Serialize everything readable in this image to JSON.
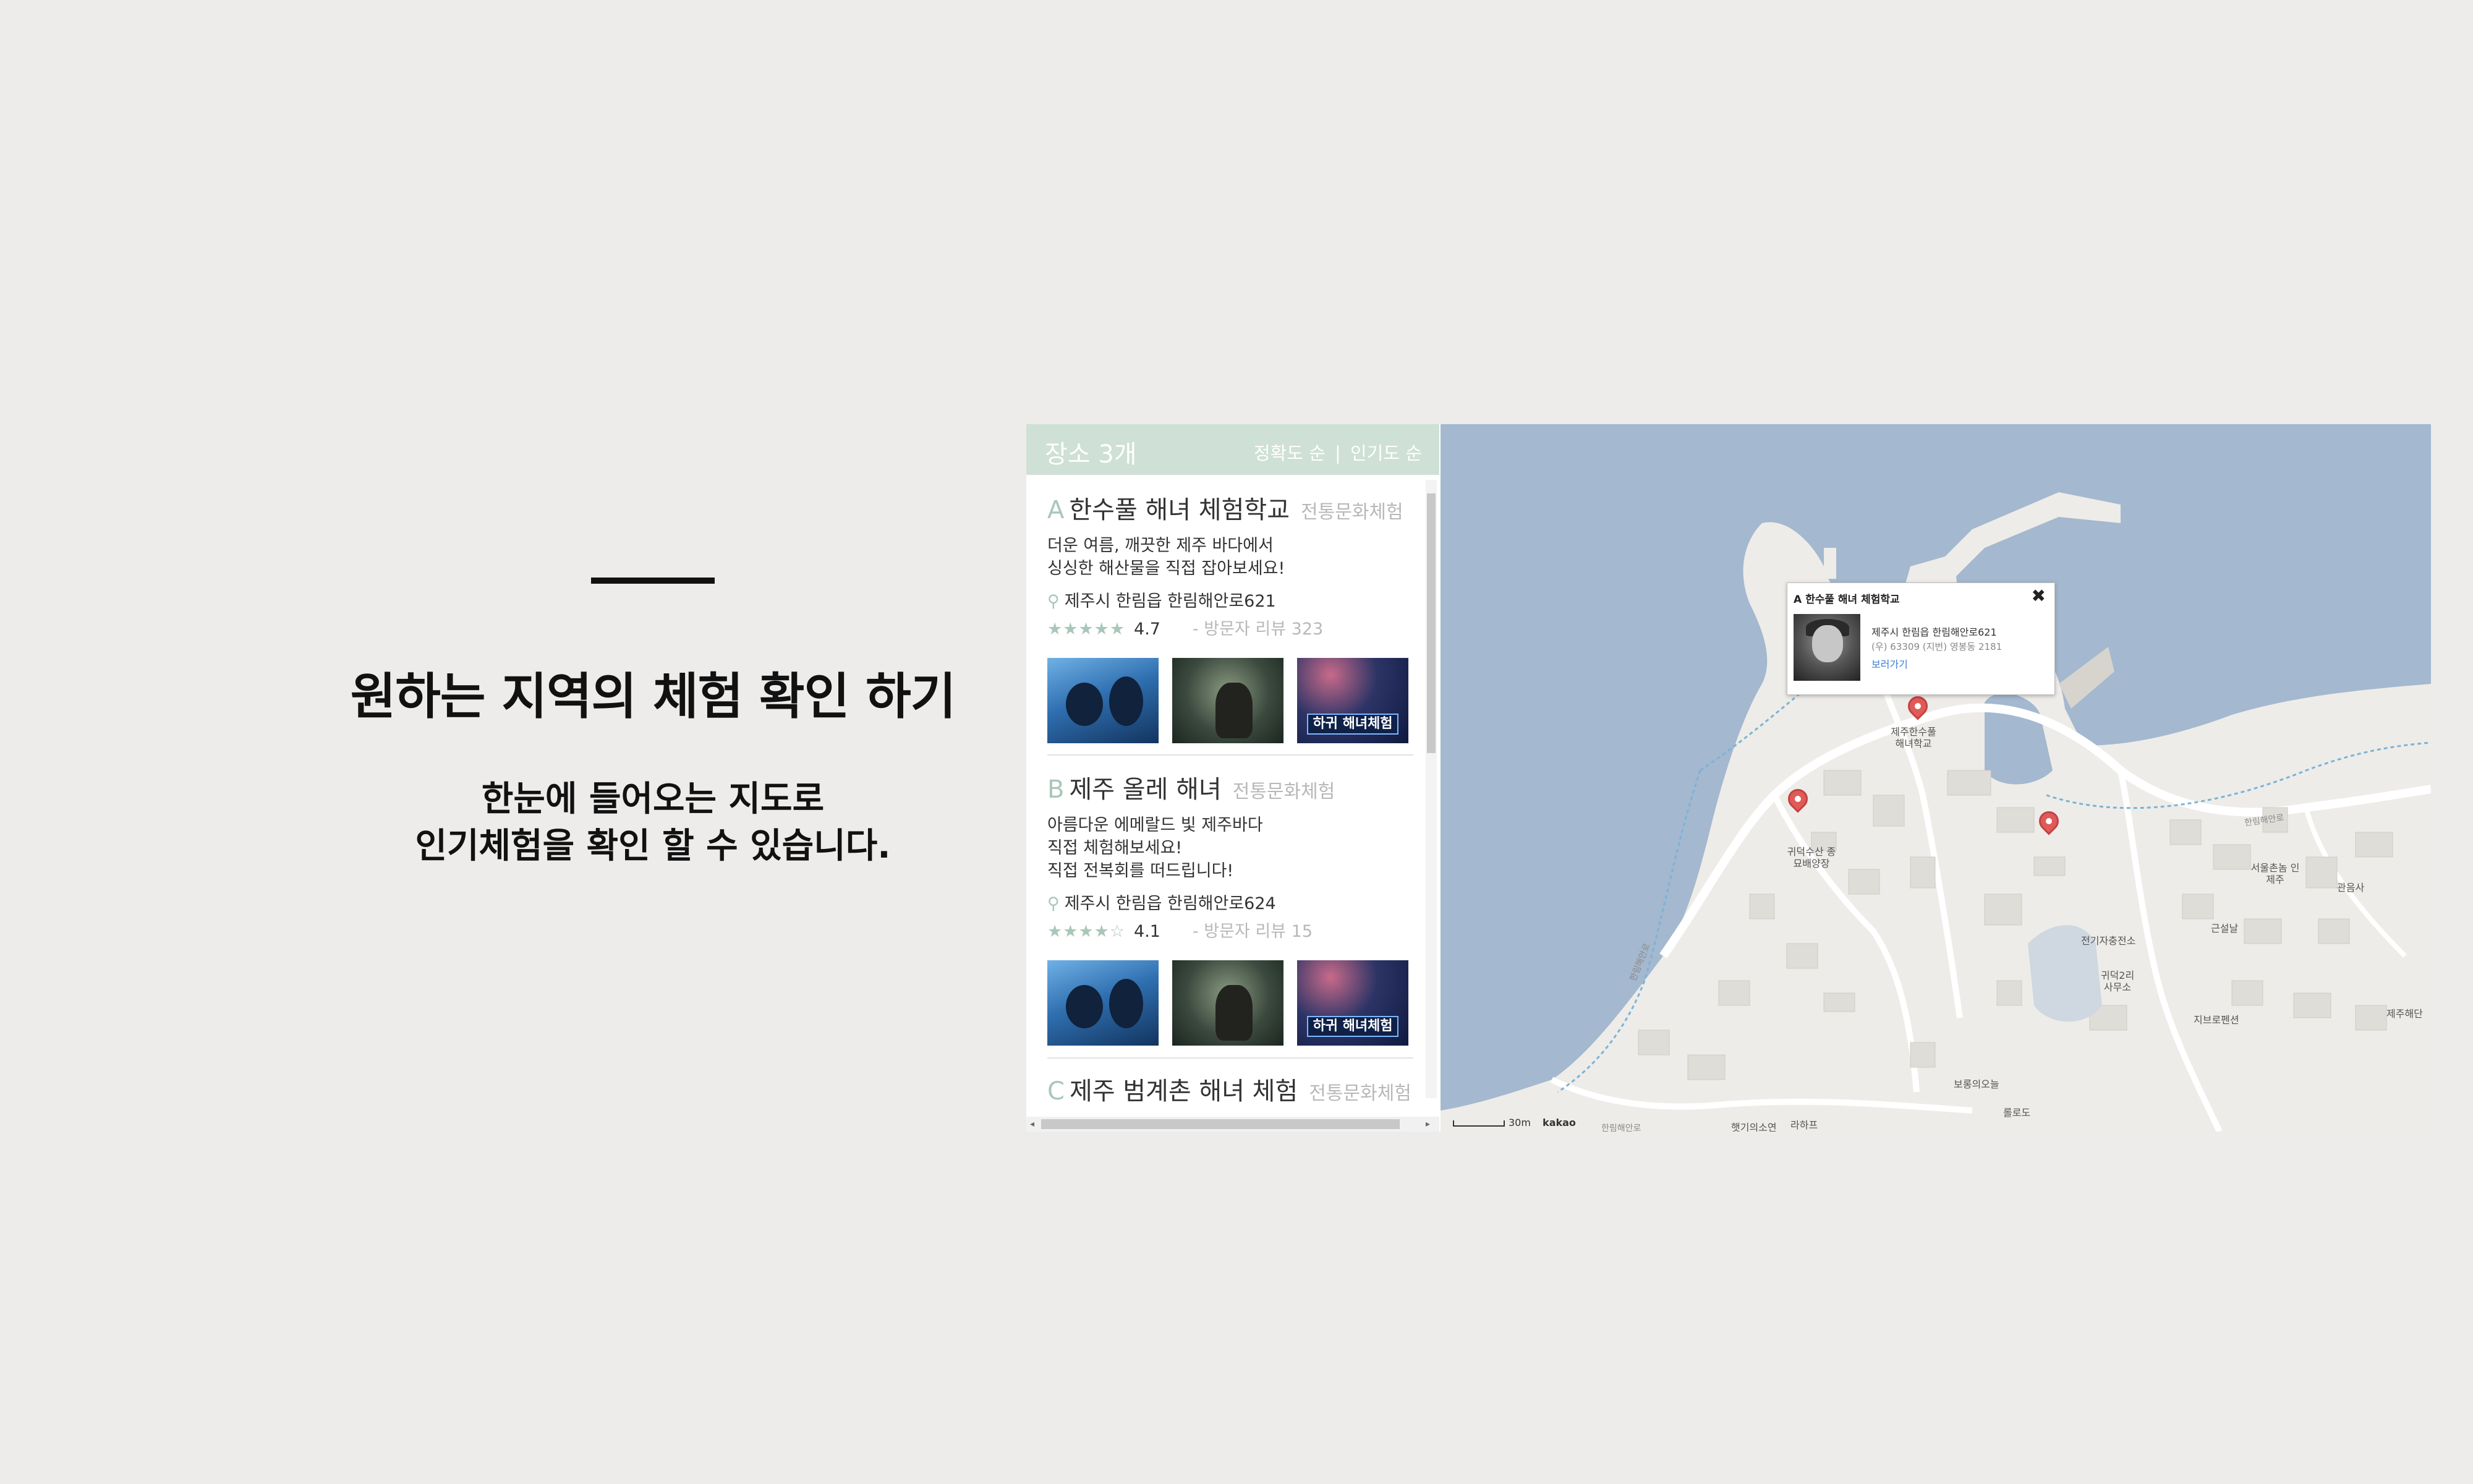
{
  "intro": {
    "title": "원하는 지역의 체험 확인 하기",
    "subtitle_line1": "한눈에 들어오는 지도로",
    "subtitle_line2": "인기체험을 확인 할 수 있습니다."
  },
  "sidebar": {
    "count_label": "장소 3개",
    "sort_accuracy": "정확도 순",
    "sort_separator": "|",
    "sort_popularity": "인기도 순",
    "places": [
      {
        "letter": "A",
        "name": "한수풀 해녀 체험학교",
        "category": "전통문화체험",
        "desc": [
          "더운 여름, 깨끗한 제주 바다에서",
          "싱싱한 해산물을 직접 잡아보세요!"
        ],
        "address": "제주시 한림읍 한림해안로621",
        "stars": "★★★★★",
        "rating": "4.7",
        "reviews": "- 방문자 리뷰 323",
        "photo_banner": "하귀 해녀체험"
      },
      {
        "letter": "B",
        "name": "제주 올레 해녀",
        "category": "전통문화체험",
        "desc": [
          "아름다운 에메랄드 빛 제주바다",
          "직접 체험해보세요!",
          "직접 전복회를 떠드립니다!"
        ],
        "address": "제주시 한림읍 한림해안로624",
        "stars": "★★★★☆",
        "rating": "4.1",
        "reviews": "- 방문자 리뷰 15",
        "photo_banner": "하귀 해녀체험"
      },
      {
        "letter": "C",
        "name": "제주 범계촌 해녀 체험",
        "category": "전통문화체험"
      }
    ]
  },
  "map": {
    "popup": {
      "title": "A 한수풀 해녀 체험학교",
      "address": "제주시 한림읍 한림해안로621",
      "zip": "(우) 63309 (지번) 영봉동 2181",
      "link": "보러가기",
      "close": "✖"
    },
    "labels": {
      "school": "제주한수풀 해녀학교",
      "fishery": "귀덕수산 종묘배양장",
      "seoul_hotel": "서울촌놈 인제주",
      "gwanumsa": "관음사",
      "geunseolnal": "근설날",
      "charging": "전기자충전소",
      "village_office": "귀덕2리 사무소",
      "jibeuro_pension": "지브로펜션",
      "jeju_haedam": "제주해단",
      "bosung": "보롱의오늘",
      "rolodo": "롤로도",
      "lahipeu": "라하프",
      "haetgi": "햇기의소연",
      "road1": "한림해안로",
      "road2": "한림해안로",
      "road3": "한림해안로",
      "scale": "30m",
      "brand": "kakao"
    },
    "colors": {
      "sea": "#a4b8cf",
      "land": "#eeece8",
      "marker": "#e05a5a",
      "accent": "#a9c7b8"
    }
  }
}
